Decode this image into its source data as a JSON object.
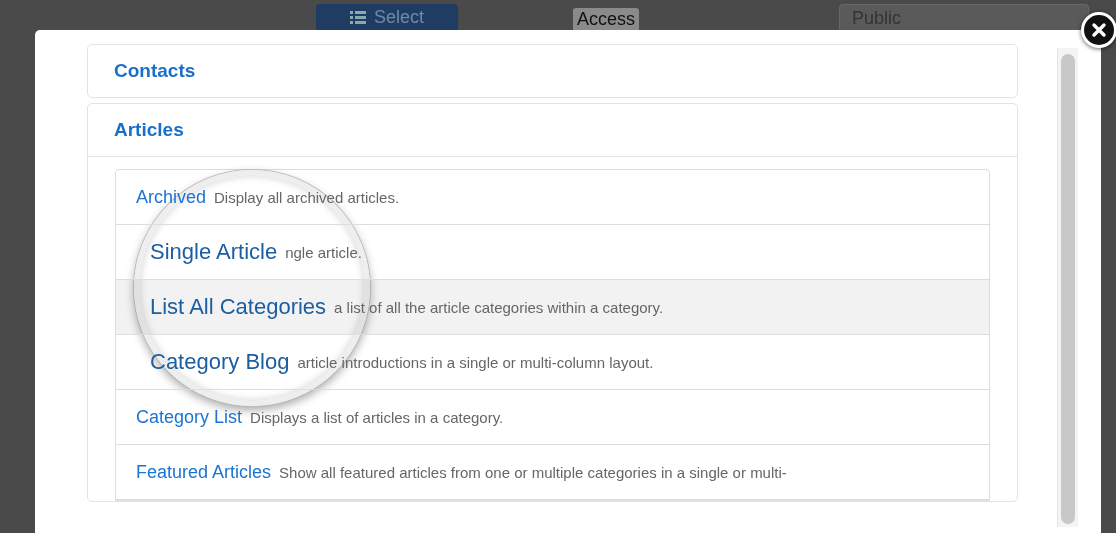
{
  "toolbar": {
    "button": "Select",
    "label": "Access",
    "field": "Public"
  },
  "panels": [
    {
      "title": "Contacts",
      "expanded": false
    },
    {
      "title": "Articles",
      "expanded": true
    }
  ],
  "items": [
    {
      "kind": "plain",
      "title": "Archived",
      "description": "Display all archived articles.",
      "selected": false
    },
    {
      "kind": "magnified",
      "title": "Single Article",
      "description": "ngle article.",
      "selected": false
    },
    {
      "kind": "magnified",
      "title": "List All Categories",
      "description": "a list of all the article categories within a category.",
      "selected": true
    },
    {
      "kind": "magnified",
      "title": "Category Blog",
      "description": "article introductions in a single or multi-column layout.",
      "selected": false
    },
    {
      "kind": "plain",
      "title": "Category List",
      "description": "Displays a list of articles in a category.",
      "selected": false
    },
    {
      "kind": "plain",
      "title": "Featured Articles",
      "description": "Show all featured articles from one or multiple categories in a single or multi-",
      "selected": false
    }
  ]
}
